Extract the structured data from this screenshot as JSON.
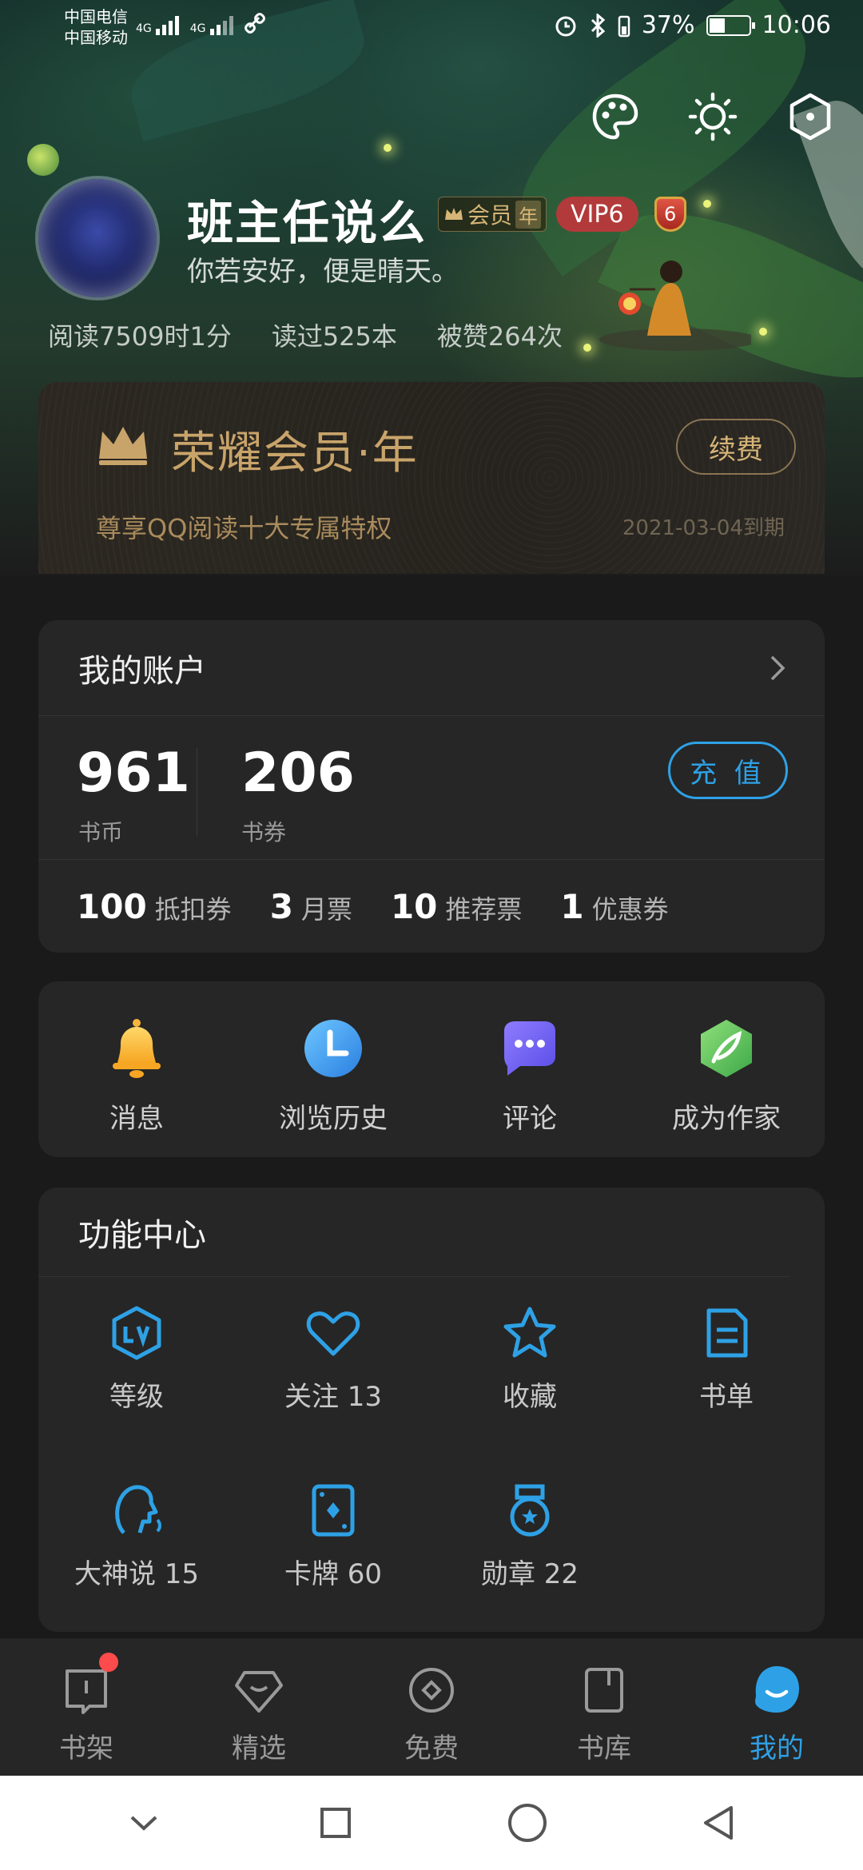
{
  "status_bar": {
    "carrier1": "中国电信",
    "carrier2": "中国移动",
    "net1": "4G",
    "net2": "4G",
    "battery": "37%",
    "time": "10:06"
  },
  "top_actions": [
    "palette-icon",
    "brightness-icon",
    "settings-hex-icon"
  ],
  "profile": {
    "name": "班主任说么",
    "member_badge": "会员",
    "member_badge_year": "年",
    "vip": "VIP6",
    "level": "6",
    "motto": "你若安好，便是晴天。",
    "stats": [
      "阅读7509时1分",
      "读过525本",
      "被赞264次"
    ]
  },
  "vip_card": {
    "title": "荣耀会员·年",
    "renew": "续费",
    "subtitle": "尊享QQ阅读十大专属特权",
    "expiry": "2021-03-04到期"
  },
  "account": {
    "title": "我的账户",
    "coins": "961",
    "coins_label": "书币",
    "vouchers": "206",
    "vouchers_label": "书券",
    "recharge": "充 值",
    "items": [
      {
        "n": "100",
        "t": "抵扣券"
      },
      {
        "n": "3",
        "t": "月票"
      },
      {
        "n": "10",
        "t": "推荐票"
      },
      {
        "n": "1",
        "t": "优惠券"
      }
    ]
  },
  "quick": [
    {
      "label": "消息",
      "icon": "bell-icon"
    },
    {
      "label": "浏览历史",
      "icon": "clock-icon"
    },
    {
      "label": "评论",
      "icon": "comment-icon"
    },
    {
      "label": "成为作家",
      "icon": "quill-icon"
    }
  ],
  "func_center": {
    "title": "功能中心",
    "items": [
      {
        "label": "等级",
        "icon": "level-icon"
      },
      {
        "label": "关注 13",
        "icon": "heart-icon"
      },
      {
        "label": "收藏",
        "icon": "star-icon"
      },
      {
        "label": "书单",
        "icon": "booklist-icon"
      },
      {
        "label": "大神说 15",
        "icon": "speaker-head-icon"
      },
      {
        "label": "卡牌 60",
        "icon": "card-icon"
      },
      {
        "label": "勋章 22",
        "icon": "medal-icon"
      }
    ]
  },
  "bottom_nav": [
    {
      "label": "书架",
      "icon": "bookshelf-icon"
    },
    {
      "label": "精选",
      "icon": "diamond-icon"
    },
    {
      "label": "免费",
      "icon": "free-icon"
    },
    {
      "label": "书库",
      "icon": "library-icon"
    },
    {
      "label": "我的",
      "icon": "profile-icon"
    }
  ],
  "colors": {
    "accent": "#2ea1e6",
    "gold": "#c9a46a",
    "vip_red": "#b33a3a",
    "background": "#1a1a1a",
    "card": "#262626"
  }
}
